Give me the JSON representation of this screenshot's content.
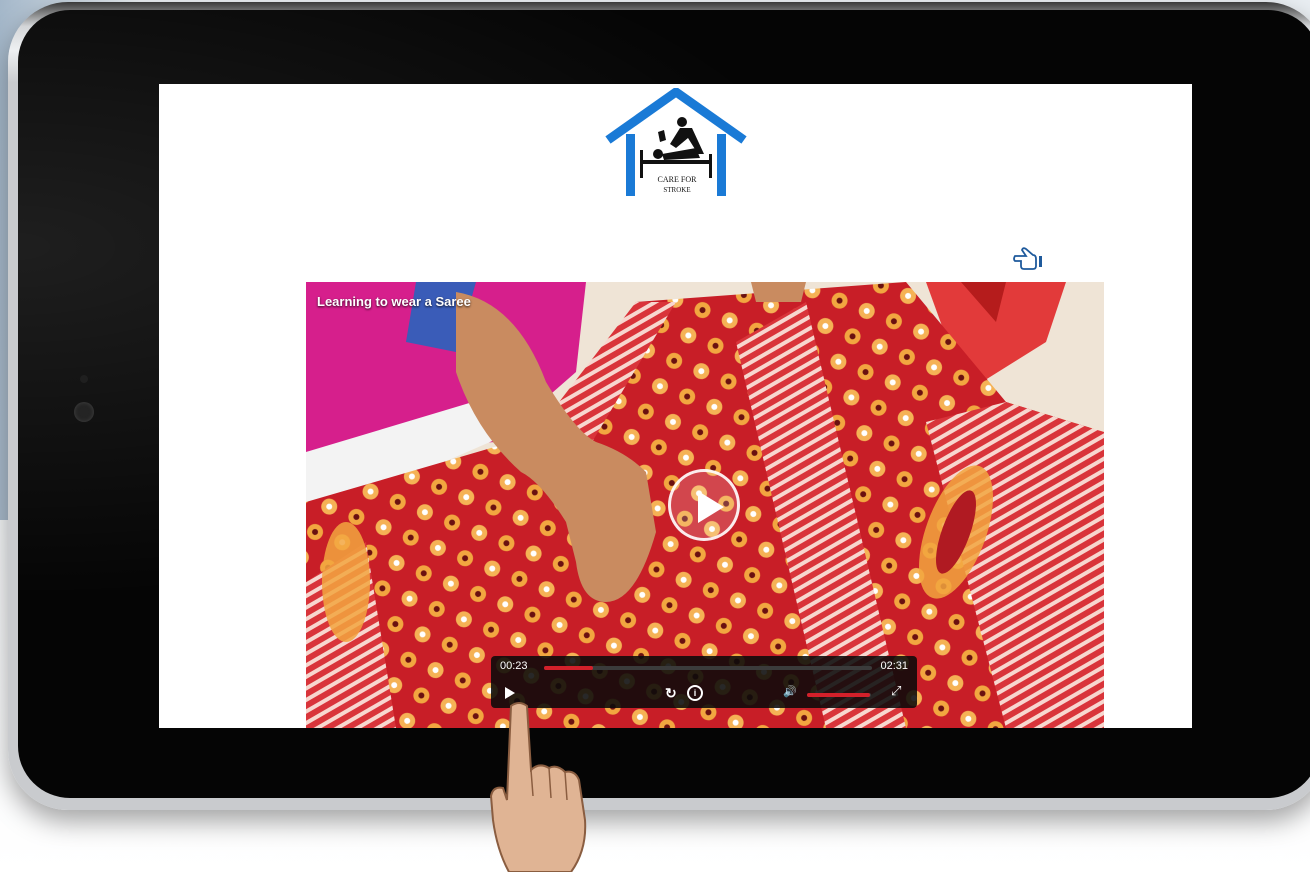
{
  "page": {
    "logo": {
      "line1": "CARE FOR",
      "line2": "STROKE"
    },
    "pointer_icon": "pointing-hand-icon"
  },
  "video": {
    "title": "Learning to wear a Saree",
    "current_time": "00:23",
    "duration": "02:31",
    "progress_fraction": 0.15,
    "volume_fraction": 0.98,
    "icons": {
      "big_play": "play-icon",
      "play": "play-icon",
      "replay": "replay-icon",
      "info": "info-icon",
      "volume": "volume-icon",
      "fullscreen": "fullscreen-icon"
    },
    "colors": {
      "accent": "#d3202a",
      "saree": "#c21c24",
      "dots": "#f2a640"
    }
  }
}
